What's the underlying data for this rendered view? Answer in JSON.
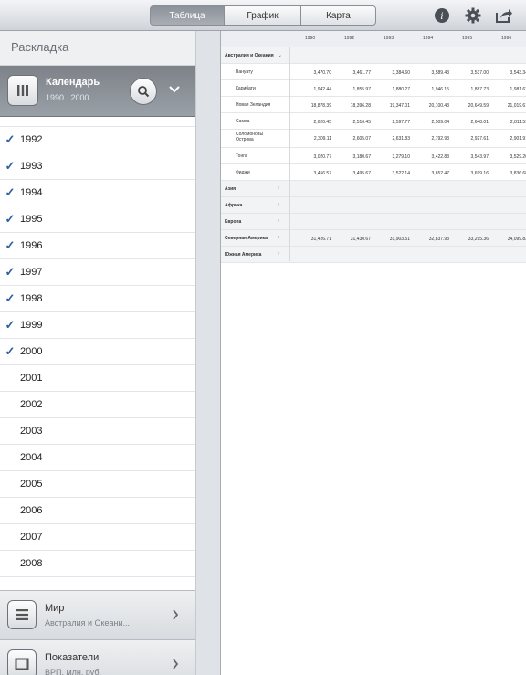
{
  "toolbar": {
    "tabs": [
      {
        "label": "Таблица",
        "active": true
      },
      {
        "label": "График",
        "active": false
      },
      {
        "label": "Карта",
        "active": false
      }
    ],
    "icons": [
      "info-icon",
      "gear-icon",
      "share-icon"
    ]
  },
  "left": {
    "title": "Раскладка",
    "calendar": {
      "title": "Календарь",
      "subtitle": "1990...2000"
    },
    "years": [
      {
        "label": "1992",
        "checked": true
      },
      {
        "label": "1993",
        "checked": true
      },
      {
        "label": "1994",
        "checked": true
      },
      {
        "label": "1995",
        "checked": true
      },
      {
        "label": "1996",
        "checked": true
      },
      {
        "label": "1997",
        "checked": true
      },
      {
        "label": "1998",
        "checked": true
      },
      {
        "label": "1999",
        "checked": true
      },
      {
        "label": "2000",
        "checked": true
      },
      {
        "label": "2001",
        "checked": false
      },
      {
        "label": "2002",
        "checked": false
      },
      {
        "label": "2003",
        "checked": false
      },
      {
        "label": "2004",
        "checked": false
      },
      {
        "label": "2005",
        "checked": false
      },
      {
        "label": "2006",
        "checked": false
      },
      {
        "label": "2007",
        "checked": false
      },
      {
        "label": "2008",
        "checked": false
      }
    ],
    "world": {
      "title": "Мир",
      "subtitle": "Австралия и Океани..."
    },
    "indicators": {
      "title": "Показатели",
      "subtitle": "ВРП, млн. руб."
    }
  },
  "table": {
    "columns": [
      "1990",
      "1992",
      "1993",
      "1994",
      "1995",
      "1996"
    ],
    "rows": [
      {
        "name": "Австралия и Океания",
        "type": "group-open",
        "values": []
      },
      {
        "name": "Вануату",
        "type": "child",
        "values": [
          "3,470.70",
          "3,461.77",
          "3,384.60",
          "3,589.43",
          "3,537.00",
          "3,543.34"
        ]
      },
      {
        "name": "Карибати",
        "type": "child",
        "values": [
          "1,942.44",
          "1,855.97",
          "1,880.27",
          "1,946.15",
          "1,887.73",
          "1,981.62"
        ]
      },
      {
        "name": "Новая Зеландия",
        "type": "child",
        "values": [
          "18,878.39",
          "18,396.28",
          "19,347.01",
          "20,100.43",
          "20,649.59",
          "21,019.61"
        ]
      },
      {
        "name": "Самоа",
        "type": "child",
        "values": [
          "2,620.45",
          "2,516.45",
          "2,597.77",
          "2,509.04",
          "2,648.01",
          "2,811.59"
        ]
      },
      {
        "name": "Соломоновы Острова",
        "type": "child",
        "values": [
          "2,309.11",
          "2,605.07",
          "2,631.83",
          "2,792.93",
          "2,927.61",
          "2,901.91"
        ]
      },
      {
        "name": "Тонга",
        "type": "child",
        "values": [
          "3,020.77",
          "3,180.67",
          "3,279.10",
          "3,422.83",
          "3,543.97",
          "3,529.20"
        ]
      },
      {
        "name": "Фиджи",
        "type": "child",
        "values": [
          "3,456.57",
          "3,495.67",
          "3,522.14",
          "3,652.47",
          "3,699.16",
          "3,836.68"
        ]
      },
      {
        "name": "Азия",
        "type": "group",
        "values": []
      },
      {
        "name": "Африка",
        "type": "group",
        "values": []
      },
      {
        "name": "Европа",
        "type": "group",
        "values": []
      },
      {
        "name": "Северная Америка",
        "type": "group",
        "values": [
          "31,426.71",
          "31,430.67",
          "31,903.51",
          "32,837.93",
          "33,295.36",
          "34,099.83"
        ]
      },
      {
        "name": "Южная Америка",
        "type": "group",
        "values": []
      }
    ]
  }
}
